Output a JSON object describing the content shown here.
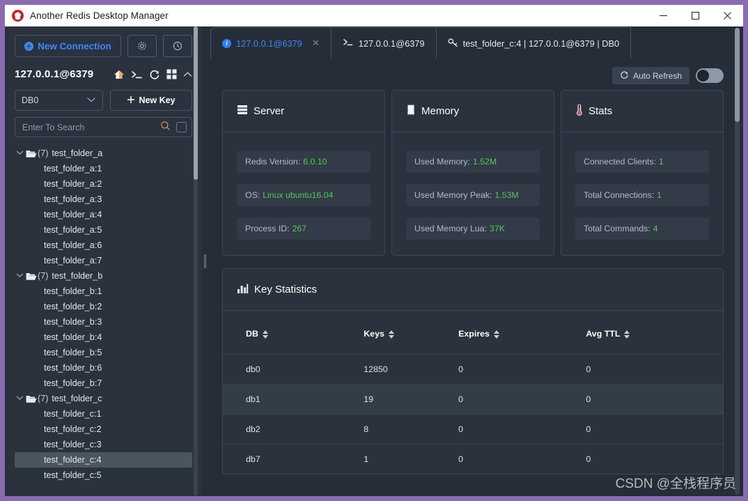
{
  "window": {
    "title": "Another Redis Desktop Manager",
    "logo_icon": "redis-logo-icon",
    "minimize_label": "—",
    "maximize_label": "□",
    "close_label": "✕"
  },
  "sidebar": {
    "new_connection_label": "New Connection",
    "settings_icon": "gear-icon",
    "history_icon": "clock-icon",
    "connection_name": "127.0.0.1@6379",
    "toolbar_icons": [
      "home-icon",
      "terminal-icon",
      "refresh-icon",
      "grid-icon",
      "chevron-up-icon"
    ],
    "db_selected": "DB0",
    "new_key_label": "New Key",
    "search_placeholder": "Enter To Search",
    "search_value": "",
    "search_icon": "search-icon",
    "tree": [
      {
        "type": "folder",
        "count": "(7)",
        "label": "test_folder_a"
      },
      {
        "type": "key",
        "label": "test_folder_a:1"
      },
      {
        "type": "key",
        "label": "test_folder_a:2"
      },
      {
        "type": "key",
        "label": "test_folder_a:3"
      },
      {
        "type": "key",
        "label": "test_folder_a:4"
      },
      {
        "type": "key",
        "label": "test_folder_a:5"
      },
      {
        "type": "key",
        "label": "test_folder_a:6"
      },
      {
        "type": "key",
        "label": "test_folder_a:7"
      },
      {
        "type": "folder",
        "count": "(7)",
        "label": "test_folder_b"
      },
      {
        "type": "key",
        "label": "test_folder_b:1"
      },
      {
        "type": "key",
        "label": "test_folder_b:2"
      },
      {
        "type": "key",
        "label": "test_folder_b:3"
      },
      {
        "type": "key",
        "label": "test_folder_b:4"
      },
      {
        "type": "key",
        "label": "test_folder_b:5"
      },
      {
        "type": "key",
        "label": "test_folder_b:6"
      },
      {
        "type": "key",
        "label": "test_folder_b:7"
      },
      {
        "type": "folder",
        "count": "(7)",
        "label": "test_folder_c"
      },
      {
        "type": "key",
        "label": "test_folder_c:1"
      },
      {
        "type": "key",
        "label": "test_folder_c:2"
      },
      {
        "type": "key",
        "label": "test_folder_c:3"
      },
      {
        "type": "key",
        "label": "test_folder_c:4",
        "selected": true
      },
      {
        "type": "key",
        "label": "test_folder_c:5"
      }
    ]
  },
  "tabs": [
    {
      "label": "127.0.0.1@6379",
      "icon": "info-icon",
      "active": true,
      "closable": true,
      "close_label": "✕"
    },
    {
      "label": "127.0.0.1@6379",
      "icon": "terminal-icon",
      "active": false
    },
    {
      "label": "test_folder_c:4 | 127.0.0.1@6379 | DB0",
      "icon": "key-icon",
      "active": false
    }
  ],
  "toolbar": {
    "auto_refresh_label": "Auto Refresh",
    "auto_refresh_icon": "refresh-icon",
    "auto_refresh_on": false
  },
  "cards": [
    {
      "title": "Server",
      "icon": "server-icon",
      "rows": [
        {
          "key": "Redis Version:",
          "value": "6.0.10"
        },
        {
          "key": "OS:",
          "value": "Linux ubuntu16.04"
        },
        {
          "key": "Process ID:",
          "value": "267"
        }
      ]
    },
    {
      "title": "Memory",
      "icon": "memory-icon",
      "rows": [
        {
          "key": "Used Memory:",
          "value": "1.52M"
        },
        {
          "key": "Used Memory Peak:",
          "value": "1.53M"
        },
        {
          "key": "Used Memory Lua:",
          "value": "37K"
        }
      ]
    },
    {
      "title": "Stats",
      "icon": "thermometer-icon",
      "rows": [
        {
          "key": "Connected Clients:",
          "value": "1"
        },
        {
          "key": "Total Connections:",
          "value": "1"
        },
        {
          "key": "Total Commands:",
          "value": "4"
        }
      ]
    }
  ],
  "key_statistics": {
    "title": "Key Statistics",
    "icon": "bar-chart-icon",
    "columns": [
      "DB",
      "Keys",
      "Expires",
      "Avg TTL"
    ],
    "rows": [
      {
        "db": "db0",
        "keys": "12850",
        "expires": "0",
        "avg_ttl": "0"
      },
      {
        "db": "db1",
        "keys": "19",
        "expires": "0",
        "avg_ttl": "0",
        "highlight": true
      },
      {
        "db": "db2",
        "keys": "8",
        "expires": "0",
        "avg_ttl": "0"
      },
      {
        "db": "db7",
        "keys": "1",
        "expires": "0",
        "avg_ttl": "0"
      }
    ]
  },
  "watermark": "CSDN @全栈程序员",
  "colors": {
    "window_border": "#8a6bb0",
    "accent_blue": "#3e88f7",
    "value_green": "#57c759",
    "panel_bg": "#2a323d",
    "content_bg": "#252d38"
  }
}
